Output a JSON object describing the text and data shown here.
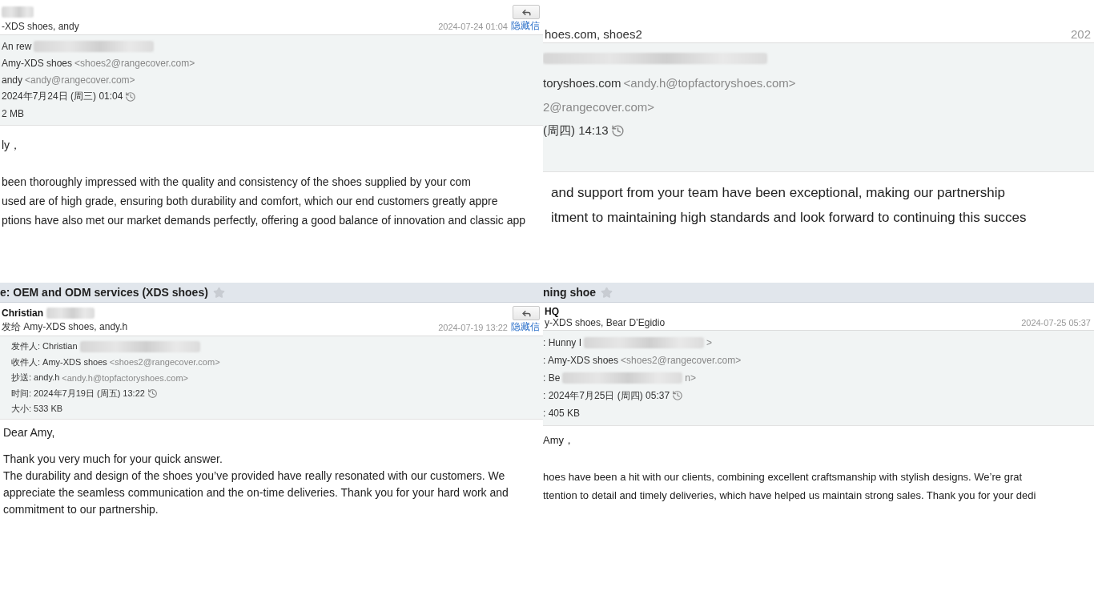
{
  "panels": [
    {
      "sender_redacted": true,
      "reply_button": true,
      "recipients": "-XDS shoes, andy",
      "date": "2024-07-24 01:04",
      "hide_link": "隐藏信",
      "details": [
        {
          "text": "An  rew",
          "redacted": true
        },
        {
          "text": "Amy-XDS shoes",
          "address": "<shoes2@rangecover.com>"
        },
        {
          "text": "andy",
          "address": "<andy@rangecover.com>"
        },
        {
          "text": "2024年7月24日 (周三) 01:04",
          "history": true
        },
        {
          "text": "2 MB"
        }
      ],
      "body": [
        [
          "ly，"
        ],
        [
          "been thoroughly impressed with the quality and consistency of the shoes supplied by your com",
          "used are of high grade, ensuring both durability and comfort, which our end customers greatly appre",
          "ptions have also met our market demands perfectly, offering a good balance of innovation and classic app"
        ]
      ]
    },
    {
      "recipients": "hoes.com, shoes2",
      "date": "202",
      "details": [
        {
          "redacted": true
        },
        {
          "text": "toryshoes.com",
          "address": "<andy.h@topfactoryshoes.com>"
        },
        {
          "address": "2@rangecover.com>"
        },
        {
          "text": "(周四) 14:13",
          "history": true
        }
      ],
      "body": [
        [
          "and support from your team have been exceptional, making our partnership",
          "itment to maintaining high standards and look forward to continuing this succes"
        ]
      ]
    },
    {
      "subject": "e: OEM and ODM services (XDS shoes)",
      "sender": "Christian",
      "sender_redacted": true,
      "reply_button": true,
      "recipients": "发给 Amy-XDS shoes, andy.h",
      "date": "2024-07-19 13:22",
      "hide_link": "隐藏信",
      "details": [
        {
          "text": "发件人: Christian",
          "redacted": true
        },
        {
          "text": "收件人: Amy-XDS shoes",
          "address": "<shoes2@rangecover.com>"
        },
        {
          "text": "抄送: andy.h",
          "address": "<andy.h@topfactoryshoes.com>"
        },
        {
          "text": "时间: 2024年7月19日 (周五) 13:22",
          "history": true
        },
        {
          "text": "大小: 533 KB"
        }
      ],
      "body": [
        [
          "Dear Amy,"
        ],
        [
          "Thank you very much for your quick answer.",
          "The durability and design of the shoes you’ve provided have really resonated with our customers. We",
          "appreciate the seamless communication and the on-time deliveries. Thank you for your hard work and",
          "commitment to our partnership."
        ]
      ]
    },
    {
      "subject": "ning shoe",
      "sender": "HQ",
      "recipients": "y-XDS shoes, Bear D’Egidio",
      "date": "2024-07-25 05:37",
      "details": [
        {
          "text": ": Hunny I",
          "redacted": true,
          "suffix": ">"
        },
        {
          "text": ": Amy-XDS shoes",
          "address": "<shoes2@rangecover.com>"
        },
        {
          "text": ": Be",
          "redacted": true,
          "suffix": "n>"
        },
        {
          "text": ": 2024年7月25日 (周四) 05:37",
          "history": true
        },
        {
          "text": ": 405 KB"
        }
      ],
      "body": [
        [
          "Amy，"
        ],
        [
          "hoes have been a hit with our clients, combining excellent craftsmanship with stylish designs. We’re grat",
          "ttention to detail and timely deliveries, which have helped us maintain strong sales. Thank you for your dedi"
        ]
      ]
    }
  ]
}
